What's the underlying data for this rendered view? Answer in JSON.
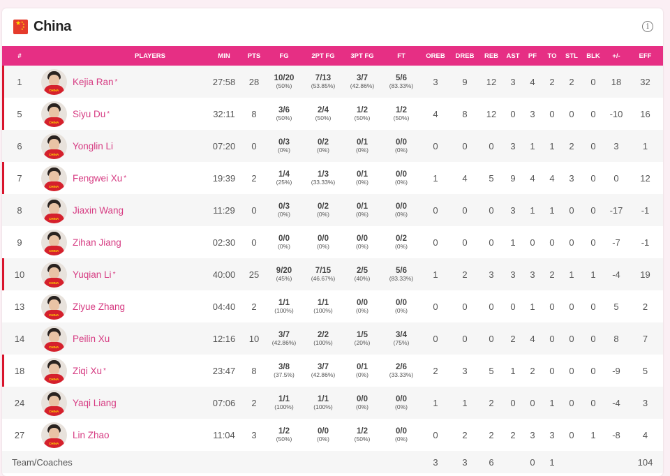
{
  "team": {
    "name": "China",
    "flag_icon": "china-flag-icon",
    "info_icon": "info-icon"
  },
  "colors": {
    "header_bg": "#e62f84",
    "name_color": "#d63b82",
    "starter_bar": "#d9142c"
  },
  "columns": [
    "#",
    "PLAYERS",
    "MIN",
    "PTS",
    "FG",
    "2PT FG",
    "3PT FG",
    "FT",
    "OREB",
    "DREB",
    "REB",
    "AST",
    "PF",
    "TO",
    "STL",
    "BLK",
    "+/-",
    "EFF"
  ],
  "starter_mark": "*",
  "players": [
    {
      "num": "1",
      "name": "Kejia Ran",
      "starter": true,
      "min": "27:58",
      "pts": "28",
      "fg": [
        "10/20",
        "(50%)"
      ],
      "fg2": [
        "7/13",
        "(53.85%)"
      ],
      "fg3": [
        "3/7",
        "(42.86%)"
      ],
      "ft": [
        "5/6",
        "(83.33%)"
      ],
      "oreb": "3",
      "dreb": "9",
      "reb": "12",
      "ast": "3",
      "pf": "4",
      "to": "2",
      "stl": "2",
      "blk": "0",
      "pm": "18",
      "eff": "32"
    },
    {
      "num": "5",
      "name": "Siyu Du",
      "starter": true,
      "min": "32:11",
      "pts": "8",
      "fg": [
        "3/6",
        "(50%)"
      ],
      "fg2": [
        "2/4",
        "(50%)"
      ],
      "fg3": [
        "1/2",
        "(50%)"
      ],
      "ft": [
        "1/2",
        "(50%)"
      ],
      "oreb": "4",
      "dreb": "8",
      "reb": "12",
      "ast": "0",
      "pf": "3",
      "to": "0",
      "stl": "0",
      "blk": "0",
      "pm": "-10",
      "eff": "16"
    },
    {
      "num": "6",
      "name": "Yonglin Li",
      "starter": false,
      "min": "07:20",
      "pts": "0",
      "fg": [
        "0/3",
        "(0%)"
      ],
      "fg2": [
        "0/2",
        "(0%)"
      ],
      "fg3": [
        "0/1",
        "(0%)"
      ],
      "ft": [
        "0/0",
        "(0%)"
      ],
      "oreb": "0",
      "dreb": "0",
      "reb": "0",
      "ast": "3",
      "pf": "1",
      "to": "1",
      "stl": "2",
      "blk": "0",
      "pm": "3",
      "eff": "1"
    },
    {
      "num": "7",
      "name": "Fengwei Xu",
      "starter": true,
      "min": "19:39",
      "pts": "2",
      "fg": [
        "1/4",
        "(25%)"
      ],
      "fg2": [
        "1/3",
        "(33.33%)"
      ],
      "fg3": [
        "0/1",
        "(0%)"
      ],
      "ft": [
        "0/0",
        "(0%)"
      ],
      "oreb": "1",
      "dreb": "4",
      "reb": "5",
      "ast": "9",
      "pf": "4",
      "to": "4",
      "stl": "3",
      "blk": "0",
      "pm": "0",
      "eff": "12"
    },
    {
      "num": "8",
      "name": "Jiaxin Wang",
      "starter": false,
      "min": "11:29",
      "pts": "0",
      "fg": [
        "0/3",
        "(0%)"
      ],
      "fg2": [
        "0/2",
        "(0%)"
      ],
      "fg3": [
        "0/1",
        "(0%)"
      ],
      "ft": [
        "0/0",
        "(0%)"
      ],
      "oreb": "0",
      "dreb": "0",
      "reb": "0",
      "ast": "3",
      "pf": "1",
      "to": "1",
      "stl": "0",
      "blk": "0",
      "pm": "-17",
      "eff": "-1"
    },
    {
      "num": "9",
      "name": "Zihan Jiang",
      "starter": false,
      "min": "02:30",
      "pts": "0",
      "fg": [
        "0/0",
        "(0%)"
      ],
      "fg2": [
        "0/0",
        "(0%)"
      ],
      "fg3": [
        "0/0",
        "(0%)"
      ],
      "ft": [
        "0/2",
        "(0%)"
      ],
      "oreb": "0",
      "dreb": "0",
      "reb": "0",
      "ast": "1",
      "pf": "0",
      "to": "0",
      "stl": "0",
      "blk": "0",
      "pm": "-7",
      "eff": "-1"
    },
    {
      "num": "10",
      "name": "Yuqian Li",
      "starter": true,
      "min": "40:00",
      "pts": "25",
      "fg": [
        "9/20",
        "(45%)"
      ],
      "fg2": [
        "7/15",
        "(46.67%)"
      ],
      "fg3": [
        "2/5",
        "(40%)"
      ],
      "ft": [
        "5/6",
        "(83.33%)"
      ],
      "oreb": "1",
      "dreb": "2",
      "reb": "3",
      "ast": "3",
      "pf": "3",
      "to": "2",
      "stl": "1",
      "blk": "1",
      "pm": "-4",
      "eff": "19"
    },
    {
      "num": "13",
      "name": "Ziyue Zhang",
      "starter": false,
      "min": "04:40",
      "pts": "2",
      "fg": [
        "1/1",
        "(100%)"
      ],
      "fg2": [
        "1/1",
        "(100%)"
      ],
      "fg3": [
        "0/0",
        "(0%)"
      ],
      "ft": [
        "0/0",
        "(0%)"
      ],
      "oreb": "0",
      "dreb": "0",
      "reb": "0",
      "ast": "0",
      "pf": "1",
      "to": "0",
      "stl": "0",
      "blk": "0",
      "pm": "5",
      "eff": "2"
    },
    {
      "num": "14",
      "name": "Peilin Xu",
      "starter": false,
      "min": "12:16",
      "pts": "10",
      "fg": [
        "3/7",
        "(42.86%)"
      ],
      "fg2": [
        "2/2",
        "(100%)"
      ],
      "fg3": [
        "1/5",
        "(20%)"
      ],
      "ft": [
        "3/4",
        "(75%)"
      ],
      "oreb": "0",
      "dreb": "0",
      "reb": "0",
      "ast": "2",
      "pf": "4",
      "to": "0",
      "stl": "0",
      "blk": "0",
      "pm": "8",
      "eff": "7"
    },
    {
      "num": "18",
      "name": "Ziqi Xu",
      "starter": true,
      "min": "23:47",
      "pts": "8",
      "fg": [
        "3/8",
        "(37.5%)"
      ],
      "fg2": [
        "3/7",
        "(42.86%)"
      ],
      "fg3": [
        "0/1",
        "(0%)"
      ],
      "ft": [
        "2/6",
        "(33.33%)"
      ],
      "oreb": "2",
      "dreb": "3",
      "reb": "5",
      "ast": "1",
      "pf": "2",
      "to": "0",
      "stl": "0",
      "blk": "0",
      "pm": "-9",
      "eff": "5"
    },
    {
      "num": "24",
      "name": "Yaqi Liang",
      "starter": false,
      "min": "07:06",
      "pts": "2",
      "fg": [
        "1/1",
        "(100%)"
      ],
      "fg2": [
        "1/1",
        "(100%)"
      ],
      "fg3": [
        "0/0",
        "(0%)"
      ],
      "ft": [
        "0/0",
        "(0%)"
      ],
      "oreb": "1",
      "dreb": "1",
      "reb": "2",
      "ast": "0",
      "pf": "0",
      "to": "1",
      "stl": "0",
      "blk": "0",
      "pm": "-4",
      "eff": "3"
    },
    {
      "num": "27",
      "name": "Lin Zhao",
      "starter": false,
      "min": "11:04",
      "pts": "3",
      "fg": [
        "1/2",
        "(50%)"
      ],
      "fg2": [
        "0/0",
        "(0%)"
      ],
      "fg3": [
        "1/2",
        "(50%)"
      ],
      "ft": [
        "0/0",
        "(0%)"
      ],
      "oreb": "0",
      "dreb": "2",
      "reb": "2",
      "ast": "2",
      "pf": "3",
      "to": "3",
      "stl": "0",
      "blk": "1",
      "pm": "-8",
      "eff": "4"
    }
  ],
  "team_row": {
    "label": "Team/Coaches",
    "oreb": "3",
    "dreb": "3",
    "reb": "6",
    "pf": "0",
    "to": "1",
    "eff": "104"
  }
}
